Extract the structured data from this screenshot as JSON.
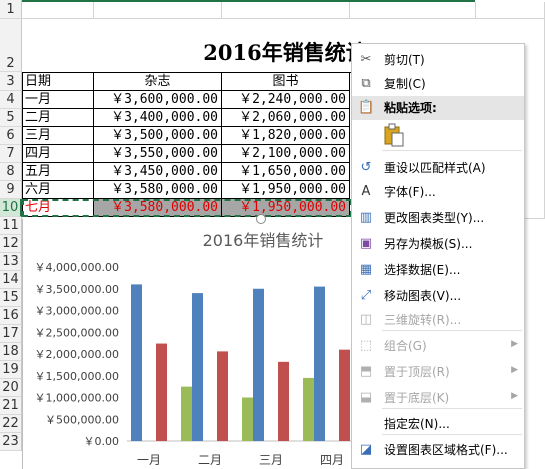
{
  "sheet": {
    "row_numbers": [
      "1",
      "2",
      "3",
      "4",
      "5",
      "6",
      "7",
      "8",
      "9",
      "10",
      "11",
      "12",
      "13",
      "14",
      "15",
      "16",
      "17",
      "18",
      "19",
      "20",
      "21",
      "22",
      "23"
    ],
    "title": "2016年销售统计",
    "headers": [
      "日期",
      "杂志",
      "图书"
    ],
    "rows": [
      {
        "month": "一月",
        "magazine": "￥3,600,000.00",
        "book": "￥2,240,000.00"
      },
      {
        "month": "二月",
        "magazine": "￥3,400,000.00",
        "book": "￥2,060,000.00"
      },
      {
        "month": "三月",
        "magazine": "￥3,500,000.00",
        "book": "￥1,820,000.00"
      },
      {
        "month": "四月",
        "magazine": "￥3,550,000.00",
        "book": "￥2,100,000.00"
      },
      {
        "month": "五月",
        "magazine": "￥3,450,000.00",
        "book": "￥1,650,000.00"
      },
      {
        "month": "六月",
        "magazine": "￥3,580,000.00",
        "book": "￥1,950,000.00"
      },
      {
        "month": "七月",
        "magazine": "￥3,580,000.00",
        "book": "￥1,950,000.00"
      }
    ],
    "colors": {
      "accent": "#217346",
      "red_text": "#e00000"
    }
  },
  "chart_data": {
    "type": "bar",
    "title": "2016年销售统计",
    "categories": [
      "一月",
      "二月",
      "三月",
      "四月"
    ],
    "series": [
      {
        "values": [
          3600000,
          3400000,
          3500000,
          3550000
        ],
        "color": "#4f81bd"
      },
      {
        "values": [
          2240000,
          2060000,
          1820000,
          2100000
        ],
        "color": "#c0504d"
      },
      {
        "values": [
          1250000,
          1000000,
          1450000,
          1250000
        ],
        "color": "#9bbb59"
      }
    ],
    "ylim": [
      0,
      4000000
    ],
    "y_ticks": [
      "￥4,000,000.00",
      "￥3,500,000.00",
      "￥3,000,000.00",
      "￥2,500,000.00",
      "￥2,000,000.00",
      "￥1,500,000.00",
      "￥1,000,000.00",
      "￥500,000.00",
      "￥0.00"
    ],
    "grid": false,
    "legend": "none"
  },
  "menu": {
    "items": [
      {
        "label": "剪切(T)",
        "icon": "scissors-icon",
        "disabled": false
      },
      {
        "label": "复制(C)",
        "icon": "copy-icon",
        "disabled": false
      },
      {
        "label": "粘贴选项:",
        "icon": "paste-icon",
        "disabled": false,
        "bold": true
      },
      {
        "label": "重设以匹配样式(A)",
        "icon": "reset-style-icon",
        "disabled": false
      },
      {
        "label": "字体(F)...",
        "icon": "font-icon",
        "disabled": false
      },
      {
        "label": "更改图表类型(Y)...",
        "icon": "chart-type-icon",
        "disabled": false
      },
      {
        "label": "另存为模板(S)...",
        "icon": "save-template-icon",
        "disabled": false
      },
      {
        "label": "选择数据(E)...",
        "icon": "select-data-icon",
        "disabled": false
      },
      {
        "label": "移动图表(V)...",
        "icon": "move-chart-icon",
        "disabled": false
      },
      {
        "label": "三维旋转(R)...",
        "icon": "3d-rotation-icon",
        "disabled": true
      },
      {
        "label": "组合(G)",
        "icon": "group-icon",
        "disabled": true,
        "submenu": true
      },
      {
        "label": "置于顶层(R)",
        "icon": "bring-front-icon",
        "disabled": true,
        "submenu": true
      },
      {
        "label": "置于底层(K)",
        "icon": "send-back-icon",
        "disabled": true,
        "submenu": true
      },
      {
        "label": "指定宏(N)...",
        "icon": "macro-icon",
        "disabled": false
      },
      {
        "label": "设置图表区域格式(F)...",
        "icon": "format-chart-area-icon",
        "disabled": false
      }
    ]
  }
}
